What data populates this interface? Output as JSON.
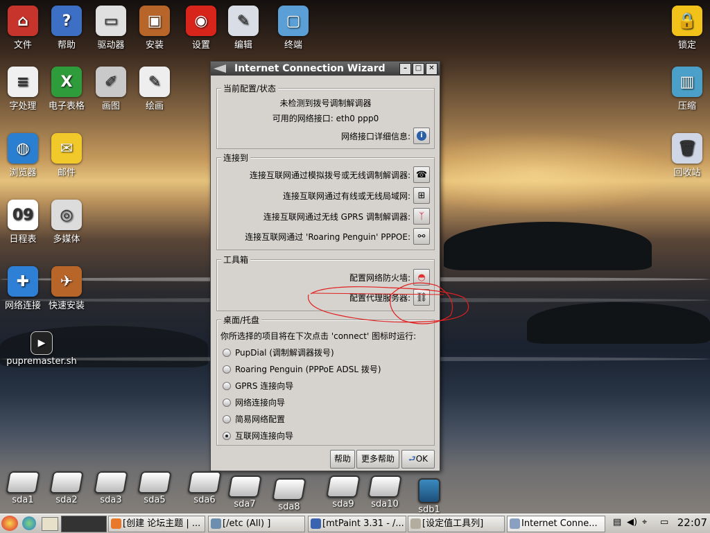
{
  "desktop": {
    "icons_left": [
      {
        "label": "文件",
        "icon": "home-icon",
        "color": "#c7342c",
        "glyph": "⌂"
      },
      {
        "label": "帮助",
        "icon": "help-icon",
        "color": "#3d6fc4",
        "glyph": "?"
      },
      {
        "label": "驱动器",
        "icon": "drive-icon",
        "color": "#e0e0e0",
        "glyph": "▭"
      },
      {
        "label": "安装",
        "icon": "briefcase-icon",
        "color": "#b8652a",
        "glyph": "▣"
      },
      {
        "label": "设置",
        "icon": "settings-icon",
        "color": "#d8251c",
        "glyph": "◉"
      },
      {
        "label": "编辑",
        "icon": "edit-icon",
        "color": "#d9dde6",
        "glyph": "✎"
      },
      {
        "label": "终端",
        "icon": "terminal-icon",
        "color": "#5aa0d6",
        "glyph": "▢"
      }
    ],
    "icons_col2": [
      {
        "label": "字处理",
        "icon": "word-processor-icon",
        "color": "#f0f0f0",
        "glyph": "≡"
      },
      {
        "label": "电子表格",
        "icon": "spreadsheet-icon",
        "color": "#2f9c3b",
        "glyph": "X"
      },
      {
        "label": "画图",
        "icon": "paint-icon",
        "color": "#c9c9c9",
        "glyph": "✐"
      },
      {
        "label": "绘画",
        "icon": "draw-icon",
        "color": "#eeeeee",
        "glyph": "✎"
      }
    ],
    "icons_col3": [
      {
        "label": "浏览器",
        "icon": "globe-icon",
        "color": "#2b7fd0",
        "glyph": "◍"
      },
      {
        "label": "邮件",
        "icon": "mail-icon",
        "color": "#f2c92b",
        "glyph": "✉"
      }
    ],
    "icons_col4": [
      {
        "label": "日程表",
        "icon": "calendar-icon",
        "color": "#ffffff",
        "glyph": "09"
      },
      {
        "label": "多媒体",
        "icon": "media-reel-icon",
        "color": "#dcdcdc",
        "glyph": "◎"
      }
    ],
    "icons_col5": [
      {
        "label": "网络连接",
        "icon": "network-icon",
        "color": "#2e7fd6",
        "glyph": "✚"
      },
      {
        "label": "快速安装",
        "icon": "toolbox-icon",
        "color": "#b8652a",
        "glyph": "✈"
      }
    ],
    "script_icon": {
      "label": "pupremaster.sh",
      "icon": "script-icon"
    },
    "icons_right": [
      {
        "label": "锁定",
        "icon": "lock-icon",
        "color": "#f2c21b",
        "glyph": "🔒"
      },
      {
        "label": "压缩",
        "icon": "archive-icon",
        "color": "#4aa0c8",
        "glyph": "▥"
      },
      {
        "label": "回收站",
        "icon": "trash-icon",
        "color": "#cfd6e6",
        "glyph": "🗑"
      }
    ],
    "drives": [
      "sda1",
      "sda2",
      "sda3",
      "sda5",
      "sda6",
      "sda7",
      "sda8",
      "sda9",
      "sda10",
      "sdb1"
    ]
  },
  "window": {
    "title": "Internet Connection Wizard",
    "current": {
      "label": "当前配置/状态",
      "line1": "未检测到拨号调制解调器",
      "line2": "可用的网络接口: eth0 ppp0",
      "details_label": "网络接口详细信息:"
    },
    "connect": {
      "label": "连接到",
      "items": [
        "连接互联网通过模拟拨号或无线调制解调器:",
        "连接互联网通过有线或无线局域网:",
        "连接互联网通过无线 GPRS 调制解调器:",
        "连接互联网通过 'Roaring Penguin' PPPOE:"
      ]
    },
    "toolbox": {
      "label": "工具箱",
      "firewall": "配置网络防火墙:",
      "proxy": "配置代理服务器:"
    },
    "tray": {
      "label": "桌面/托盘",
      "desc": "你所选择的项目将在下次点击 'connect' 图标时运行:",
      "options": [
        {
          "label": "PupDial (调制解调器拨号)",
          "selected": false
        },
        {
          "label": "Roaring Penguin (PPPoE ADSL 拨号)",
          "selected": false
        },
        {
          "label": "GPRS 连接向导",
          "selected": false
        },
        {
          "label": "网络连接向导",
          "selected": false
        },
        {
          "label": "简易网络配置",
          "selected": false
        },
        {
          "label": "互联网连接向导",
          "selected": true
        }
      ]
    },
    "buttons": {
      "help": "帮助",
      "more_help": "更多帮助",
      "ok": "OK"
    }
  },
  "taskbar": {
    "items": [
      "[创建 论坛主题 | ...",
      "[/etc (All) ]",
      "[mtPaint 3.31 - /...",
      "[设定值工具列]",
      "Internet Conne..."
    ],
    "clock": "22:07"
  },
  "annotation_color": "#e02020"
}
